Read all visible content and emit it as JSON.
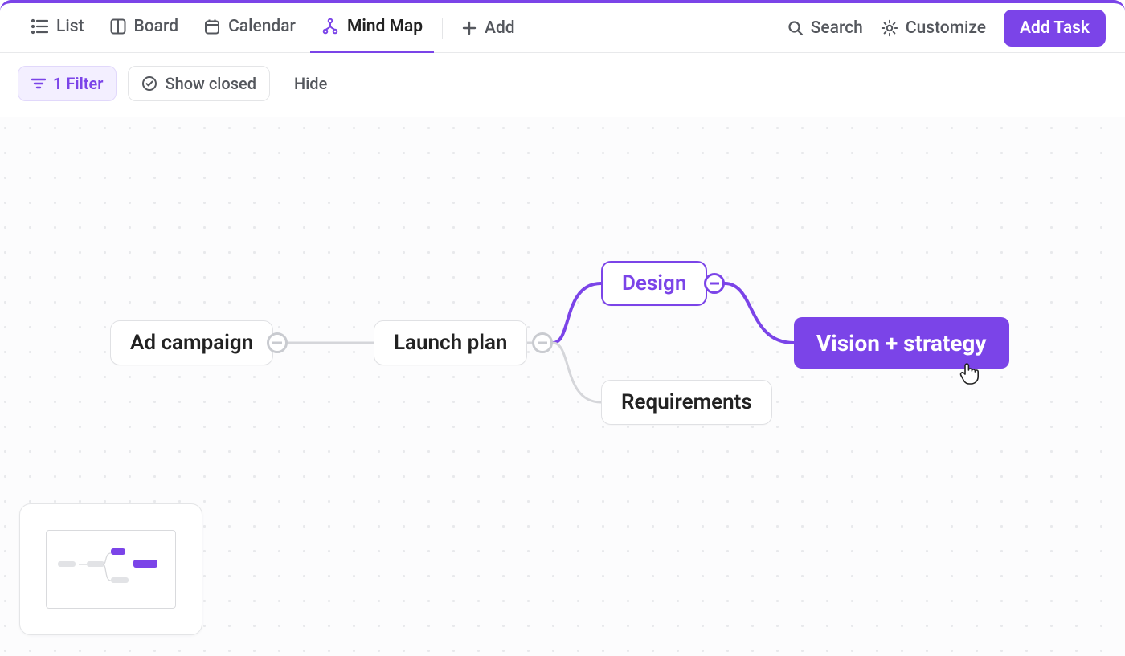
{
  "colors": {
    "accent": "#7b44e8"
  },
  "views": [
    {
      "id": "list",
      "label": "List",
      "icon": "list"
    },
    {
      "id": "board",
      "label": "Board",
      "icon": "board"
    },
    {
      "id": "calendar",
      "label": "Calendar",
      "icon": "calendar"
    },
    {
      "id": "mindmap",
      "label": "Mind Map",
      "icon": "mindmap",
      "active": true
    }
  ],
  "add_view_label": "Add",
  "topbar_actions": {
    "search_label": "Search",
    "customize_label": "Customize",
    "add_task_label": "Add Task"
  },
  "filters": {
    "filter_chip_label": "1 Filter",
    "show_closed_label": "Show closed",
    "hide_label": "Hide"
  },
  "mindmap": {
    "nodes": {
      "root": {
        "label": "Ad campaign"
      },
      "launch": {
        "label": "Launch plan"
      },
      "design": {
        "label": "Design"
      },
      "requirements": {
        "label": "Requirements"
      },
      "vision": {
        "label": "Vision + strategy"
      }
    }
  }
}
